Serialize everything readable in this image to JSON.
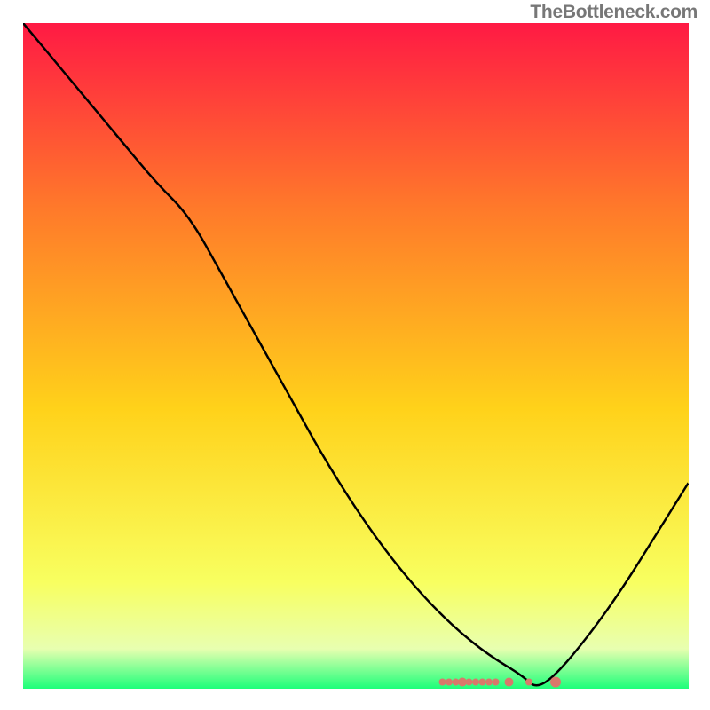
{
  "watermark": "TheBottleneck.com",
  "chart_data": {
    "type": "line",
    "title": "",
    "xlabel": "",
    "ylabel": "",
    "xlim": [
      0,
      100
    ],
    "ylim": [
      0,
      100
    ],
    "grid": false,
    "background_gradient": {
      "top": "#ff1a44",
      "mid_upper": "#ff7a2a",
      "mid": "#ffd21a",
      "mid_lower": "#f8ff60",
      "bottom": "#1dff7a"
    },
    "series": [
      {
        "name": "curve",
        "color": "#000000",
        "x": [
          0,
          5,
          10,
          15,
          20,
          25,
          30,
          35,
          40,
          45,
          50,
          55,
          60,
          65,
          70,
          75,
          77,
          80,
          85,
          90,
          95,
          100
        ],
        "y": [
          100,
          94,
          88,
          82,
          76,
          71,
          62,
          53,
          44,
          35,
          27,
          20,
          14,
          9,
          5,
          2,
          0,
          2,
          8,
          15,
          23,
          31
        ]
      }
    ],
    "markers": {
      "name": "bottom-markers",
      "color": "#d9786b",
      "x": [
        63,
        64,
        65,
        66,
        67,
        68,
        69,
        70,
        71,
        73,
        76,
        80
      ],
      "y": [
        1,
        1,
        1,
        1,
        1,
        1,
        1,
        1,
        1,
        1,
        1,
        1
      ],
      "radius": [
        4,
        4,
        4,
        5,
        4,
        4,
        4,
        4,
        4,
        5,
        4,
        6
      ]
    }
  }
}
